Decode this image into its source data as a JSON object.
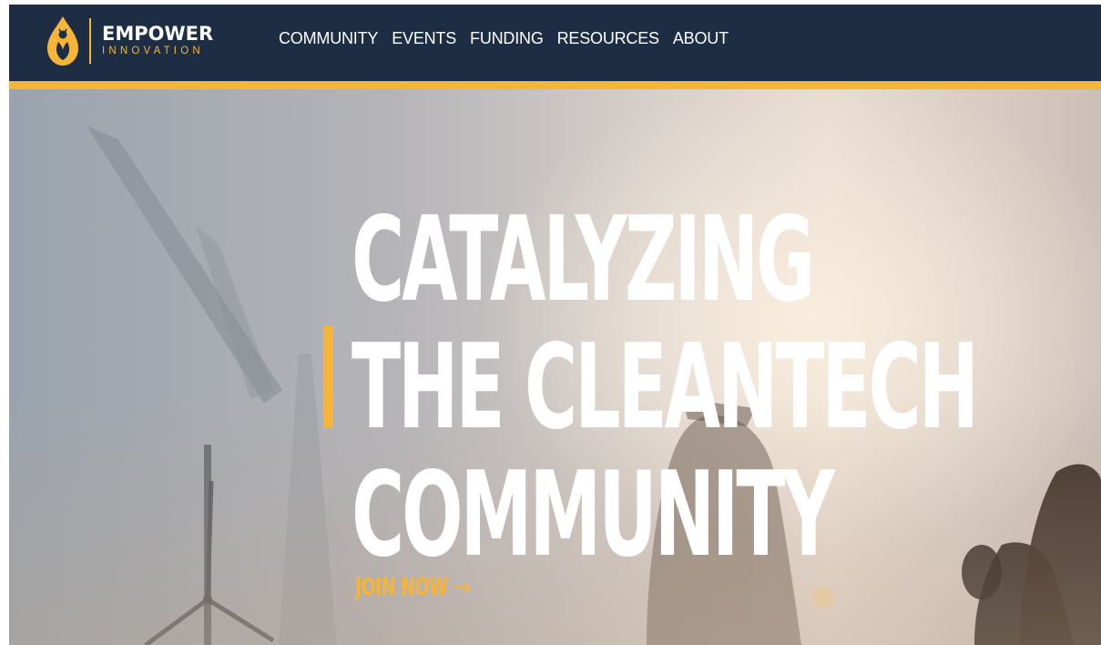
{
  "brand": {
    "name_primary": "EMPOWER",
    "name_secondary": "INNOVATION"
  },
  "nav": {
    "items": [
      {
        "label": "COMMUNITY"
      },
      {
        "label": "EVENTS"
      },
      {
        "label": "FUNDING"
      },
      {
        "label": "RESOURCES"
      },
      {
        "label": "ABOUT"
      }
    ]
  },
  "hero": {
    "headline_lines": [
      "CATALYZING",
      "THE CLEANTECH",
      "COMMUNITY"
    ],
    "cta_label": "JOIN NOW",
    "cta_arrow": "→"
  },
  "colors": {
    "navbar": "#1d2d44",
    "accent": "#f7b538",
    "text_light": "#ffffff"
  },
  "icons": {
    "logo": "drop-leaf-logo-icon",
    "cta": "arrow-right-icon"
  }
}
